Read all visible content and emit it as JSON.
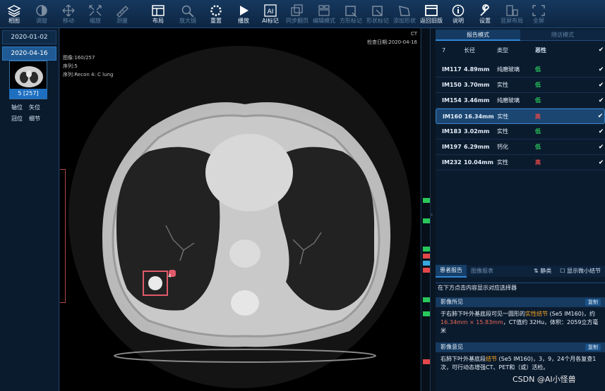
{
  "toolbar": {
    "items": [
      {
        "label": "相图",
        "icon": "layers-icon",
        "active": true
      },
      {
        "label": "调窗",
        "icon": "contrast-icon",
        "active": false
      },
      {
        "label": "移动",
        "icon": "move-icon",
        "active": false
      },
      {
        "label": "缩放",
        "icon": "zoom-expand-icon",
        "active": false
      },
      {
        "label": "测量",
        "icon": "ruler-icon",
        "active": false
      },
      {
        "label": "布局",
        "icon": "layout-icon",
        "active": true
      },
      {
        "label": "放大镜",
        "icon": "magnifier-icon",
        "active": false
      },
      {
        "label": "重置",
        "icon": "reset-icon",
        "active": true
      },
      {
        "label": "播放",
        "icon": "play-icon",
        "active": true
      },
      {
        "label": "AI标记",
        "icon": "ai-icon",
        "active": true
      },
      {
        "label": "同步翻页",
        "icon": "sync-icon",
        "active": false
      },
      {
        "label": "编辑模式",
        "icon": "edit-icon",
        "active": false
      },
      {
        "label": "方形标记",
        "icon": "square-mark-icon",
        "active": false
      },
      {
        "label": "形状标记",
        "icon": "shape-mark-icon",
        "active": false
      },
      {
        "label": "添加形状",
        "icon": "add-shape-icon",
        "active": false
      },
      {
        "label": "返回旧版",
        "icon": "window-icon",
        "active": true
      },
      {
        "label": "说明",
        "icon": "info-icon",
        "active": true
      },
      {
        "label": "设置",
        "icon": "wrench-icon",
        "active": true
      },
      {
        "label": "竖屏布局",
        "icon": "portrait-icon",
        "active": false
      },
      {
        "label": "全屏",
        "icon": "fullscreen-icon",
        "active": false
      }
    ]
  },
  "sidebar": {
    "dates": [
      {
        "label": "2020-01-02",
        "active": false
      },
      {
        "label": "2020-04-16",
        "active": true
      }
    ],
    "thumbnail_caption": "5 [257]",
    "views": [
      "轴位",
      "矢位",
      "冠位",
      "细节"
    ]
  },
  "viewer": {
    "modality": "CT",
    "exam_date": "检查日期:2020-04-16",
    "image_index": "图像:160/257",
    "series": "序列:5",
    "series_desc": "序列:Recon 4: C lung",
    "nodule_tag": "4"
  },
  "panel": {
    "tabs": [
      "报告模式",
      "随访模式"
    ],
    "active_tab": 0,
    "columns": {
      "count": "7",
      "diameter": "长径",
      "type": "类型",
      "risk": "恶性"
    },
    "nodules": [
      {
        "id": "IM117",
        "size": "4.89mm",
        "type": "纯磨玻璃",
        "risk": "低",
        "high": false,
        "checked": true
      },
      {
        "id": "IM150",
        "size": "3.70mm",
        "type": "实性",
        "risk": "低",
        "high": false,
        "checked": true
      },
      {
        "id": "IM154",
        "size": "3.46mm",
        "type": "纯磨玻璃",
        "risk": "低",
        "high": false,
        "checked": true
      },
      {
        "id": "IM160",
        "size": "16.34mm",
        "type": "实性",
        "risk": "高",
        "high": true,
        "checked": true
      },
      {
        "id": "IM183",
        "size": "3.02mm",
        "type": "实性",
        "risk": "低",
        "high": false,
        "checked": true
      },
      {
        "id": "IM197",
        "size": "6.29mm",
        "type": "钙化",
        "risk": "低",
        "high": false,
        "checked": true
      },
      {
        "id": "IM232",
        "size": "10.04mm",
        "type": "实性",
        "risk": "高",
        "high": true,
        "checked": true
      }
    ],
    "selected_index": 3,
    "bottom_tabs": [
      "患者报告",
      "图像报表"
    ],
    "sort_label": "静类",
    "show_small_label": "显示微小结节",
    "hint": "在下方点击内容显示对应选择器",
    "findings_title": "影像所见",
    "findings_text_a": "于右肺下叶外基底段可见一圆形的",
    "findings_hl": "实性结节",
    "findings_text_b": " (Se5 IM160)，约 ",
    "findings_size": "16.34mm × 15.83mm",
    "findings_text_c": "，CT值约 32Hu，体积：2059立方毫米",
    "opinion_title": "影像意见",
    "opinion_text_a": "右肺下叶外基底段",
    "opinion_hl": "结节",
    "opinion_text_b": " (Se5 IM160)，3，9，24个月各复查1次，可行动态增强CT、PET和（或）活检。",
    "copy_label": "复制"
  },
  "watermark": "CSDN @AI小怪兽",
  "colors": {
    "accent": "#2e86d6",
    "low": "#28c85a",
    "high": "#e2474a",
    "nodule_box": "#e05a6a"
  }
}
